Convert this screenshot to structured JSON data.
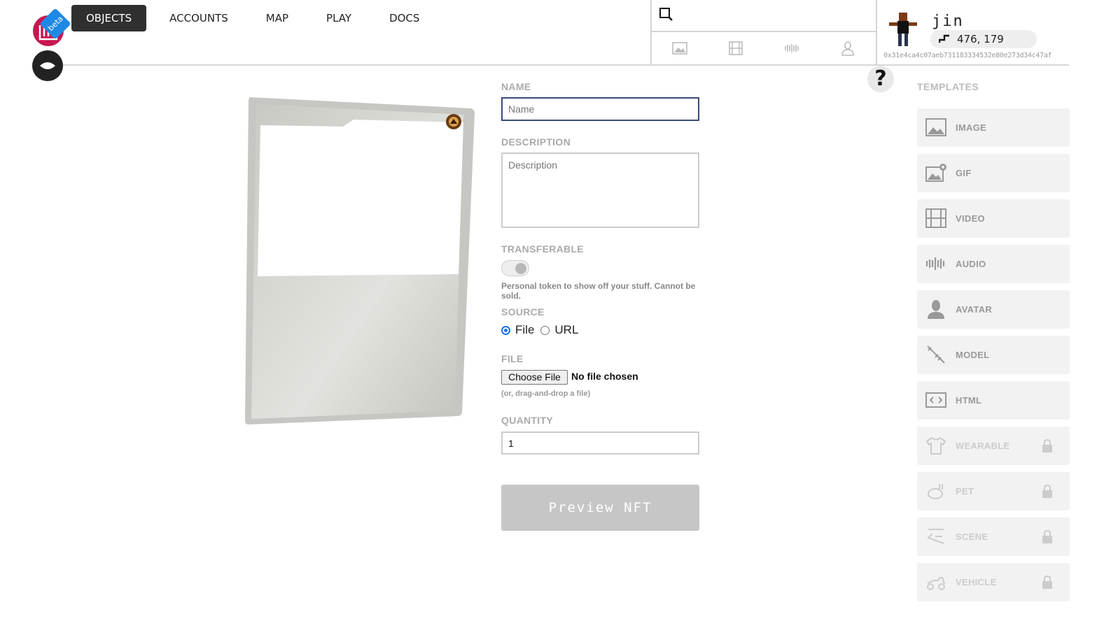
{
  "nav": {
    "items": [
      "OBJECTS",
      "ACCOUNTS",
      "MAP",
      "PLAY",
      "DOCS"
    ],
    "active": "OBJECTS"
  },
  "logo": {
    "badge": "beta"
  },
  "search": {
    "icon": "search-icon",
    "filters": [
      "image-filter-icon",
      "video-filter-icon",
      "audio-filter-icon",
      "avatar-filter-icon"
    ]
  },
  "profile": {
    "username": "jin",
    "coords": "476, 179",
    "address": "0x31e4ca4c07aeb731183334532e80e273d34c47af"
  },
  "help": {
    "label": "?"
  },
  "form": {
    "name_label": "NAME",
    "name_placeholder": "Name",
    "description_label": "DESCRIPTION",
    "description_placeholder": "Description",
    "transferable_label": "TRANSFERABLE",
    "transferable_hint": "Personal token to show off your stuff. Cannot be sold.",
    "source_label": "SOURCE",
    "source_options": [
      "File",
      "URL"
    ],
    "source_selected": "File",
    "file_label": "FILE",
    "choose_file": "Choose File",
    "no_file": "No file chosen",
    "file_hint": "(or, drag-and-drop a file)",
    "quantity_label": "QUANTITY",
    "quantity_value": "1",
    "preview_button": "Preview NFT"
  },
  "templates": {
    "title": "TEMPLATES",
    "items": [
      {
        "label": "IMAGE",
        "icon": "image-icon",
        "locked": false
      },
      {
        "label": "GIF",
        "icon": "gif-icon",
        "locked": false
      },
      {
        "label": "VIDEO",
        "icon": "video-icon",
        "locked": false
      },
      {
        "label": "AUDIO",
        "icon": "audio-icon",
        "locked": false
      },
      {
        "label": "AVATAR",
        "icon": "avatar-icon",
        "locked": false
      },
      {
        "label": "MODEL",
        "icon": "model-icon",
        "locked": false
      },
      {
        "label": "HTML",
        "icon": "html-icon",
        "locked": false
      },
      {
        "label": "WEARABLE",
        "icon": "wearable-icon",
        "locked": true
      },
      {
        "label": "PET",
        "icon": "pet-icon",
        "locked": true
      },
      {
        "label": "SCENE",
        "icon": "scene-icon",
        "locked": true
      },
      {
        "label": "VEHICLE",
        "icon": "vehicle-icon",
        "locked": true
      }
    ]
  },
  "colors": {
    "logo": "#c8174f",
    "beta": "#1e88e5",
    "nav_active": "#2f2f2f",
    "input_focus": "#3a4a7a",
    "preview_button": "#c6c6c6"
  }
}
